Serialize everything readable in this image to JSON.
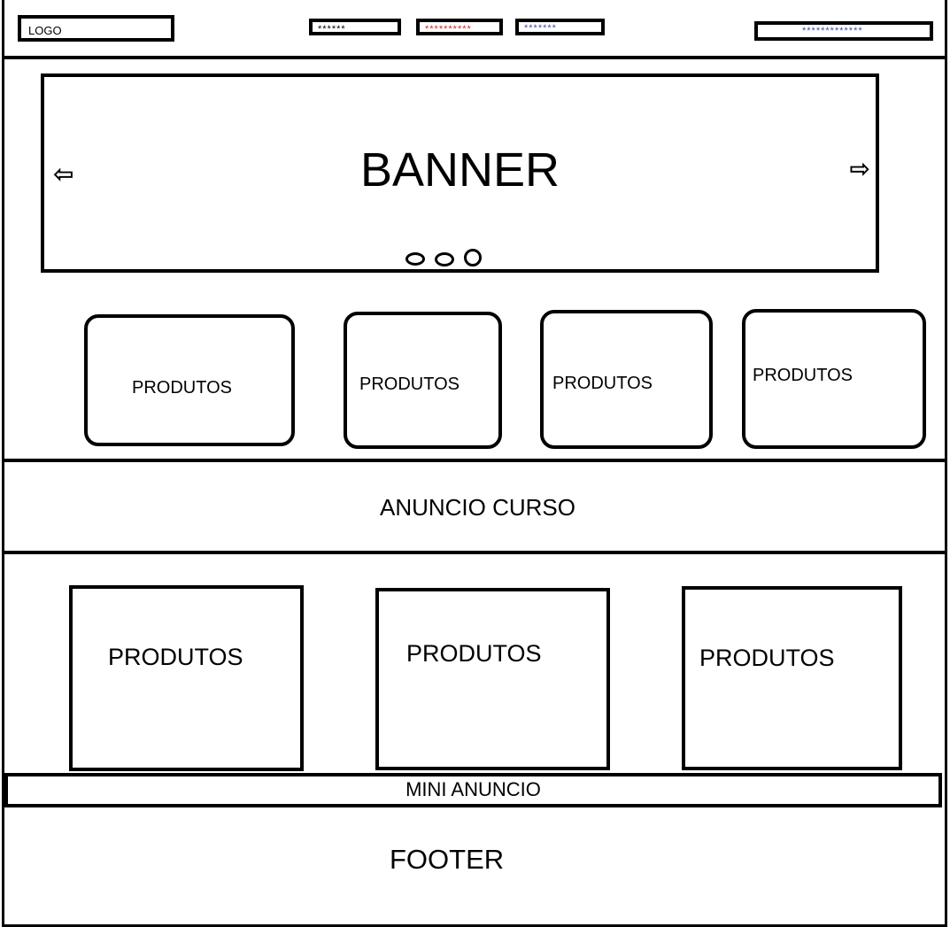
{
  "header": {
    "logo": "LOGO",
    "nav": [
      "******",
      "**********",
      "*******"
    ],
    "search_placeholder": "*************"
  },
  "banner": {
    "title": "BANNER",
    "prev_icon": "arrow-left-icon",
    "next_icon": "arrow-right-icon",
    "slide_count": 3
  },
  "products_top": [
    "PRODUTOS",
    "PRODUTOS",
    "PRODUTOS",
    "PRODUTOS"
  ],
  "ad": {
    "label": "ANUNCIO CURSO"
  },
  "products_bottom": [
    "PRODUTOS",
    "PRODUTOS",
    "PRODUTOS"
  ],
  "mini_ad": {
    "label": "MINI ANUNCIO"
  },
  "footer": {
    "label": "FOOTER"
  }
}
